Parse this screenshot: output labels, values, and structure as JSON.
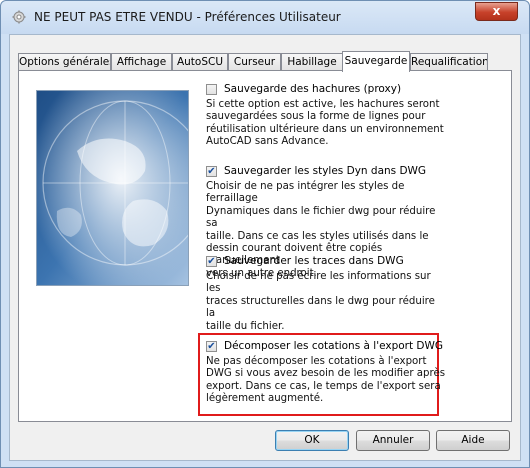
{
  "window": {
    "title": "NE PEUT PAS ETRE VENDU - Préférences Utilisateur",
    "close_label": "x"
  },
  "tabs": [
    {
      "label": "Options générales"
    },
    {
      "label": "Affichage"
    },
    {
      "label": "AutoSCU"
    },
    {
      "label": "Curseur"
    },
    {
      "label": "Habillage"
    },
    {
      "label": "Sauvegarde",
      "active": true
    },
    {
      "label": "Requalification"
    }
  ],
  "options": [
    {
      "label": "Sauvegarde des hachures (proxy)",
      "checked": false,
      "description": [
        "Si cette option est active, les hachures seront",
        "sauvegardées sous la forme de lignes pour",
        "réutilisation ultérieure dans un environnement",
        "AutoCAD sans Advance."
      ]
    },
    {
      "label": "Sauvegarder les styles Dyn dans DWG",
      "checked": true,
      "description": [
        "Choisir de ne pas intégrer les styles de ferraillage",
        "Dynamiques dans le fichier dwg  pour réduire sa",
        "taille. Dans ce cas les styles utilisés dans le",
        "dessin courant doivent être copiés manuellement",
        "vers un autre endroit."
      ]
    },
    {
      "label": "Sauvegarder les traces dans DWG",
      "checked": true,
      "description": [
        "Choisir de ne pas écrire les informations sur les",
        "traces structurelles dans le dwg pour réduire la",
        "taille du fichier."
      ]
    },
    {
      "label": "Décomposer les cotations à l'export DWG",
      "checked": true,
      "highlighted": true,
      "description": [
        "Ne pas décomposer les cotations à l'export",
        "DWG si vous avez besoin de les modifier après",
        "export. Dans ce cas, le temps de l'export sera",
        "légèrement augmenté."
      ]
    }
  ],
  "buttons": {
    "ok": "OK",
    "cancel": "Annuler",
    "help": "Aide"
  },
  "colors": {
    "highlight_border": "#e01b1b",
    "window_frame": "#cfe0f4"
  },
  "icons": {
    "app": "gear-app-icon",
    "illustration": "globe-map-illustration"
  }
}
